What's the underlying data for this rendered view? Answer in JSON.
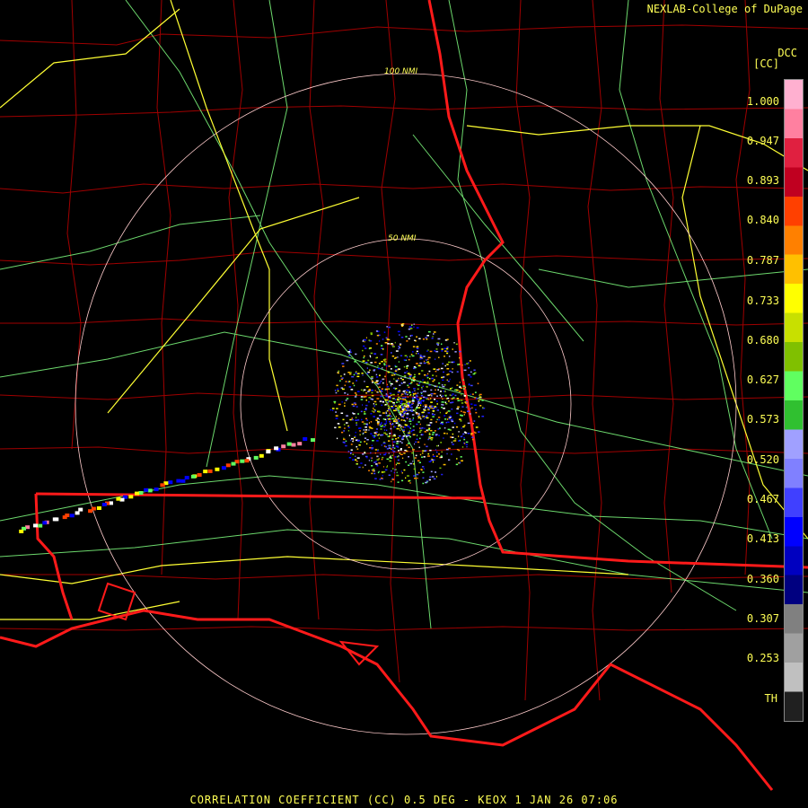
{
  "credit": "NEXLAB-College of DuPage",
  "footer": "CORRELATION COEFFICIENT (CC) 0.5 DEG - KEOX 1 JAN 26 07:06",
  "legend": {
    "product": "DCC",
    "unit": "[CC]",
    "ticks": [
      "1.000",
      "0.947",
      "0.893",
      "0.840",
      "0.787",
      "0.733",
      "0.680",
      "0.627",
      "0.573",
      "0.520",
      "0.467",
      "0.413",
      "0.360",
      "0.307",
      "0.253",
      "TH"
    ],
    "colors": [
      "#ffb0d0",
      "#ff80a0",
      "#e02040",
      "#c00020",
      "#ff4000",
      "#ff8000",
      "#ffc000",
      "#ffff00",
      "#c8e000",
      "#80c000",
      "#60ff60",
      "#30c030",
      "#a0a0ff",
      "#8080ff",
      "#4040ff",
      "#0000ff",
      "#0000c0",
      "#000080",
      "#808080",
      "#a0a0a0",
      "#c0c0c0",
      "#202020"
    ]
  },
  "range_rings": {
    "outer": "100 NMI",
    "inner": "50 NMI"
  },
  "colors": {
    "boundary": "#ff0000",
    "county": "#b00000",
    "highway": "#ffff44",
    "road": "#88ff88",
    "ring": "#ffcccc",
    "text": "#ffff55"
  }
}
